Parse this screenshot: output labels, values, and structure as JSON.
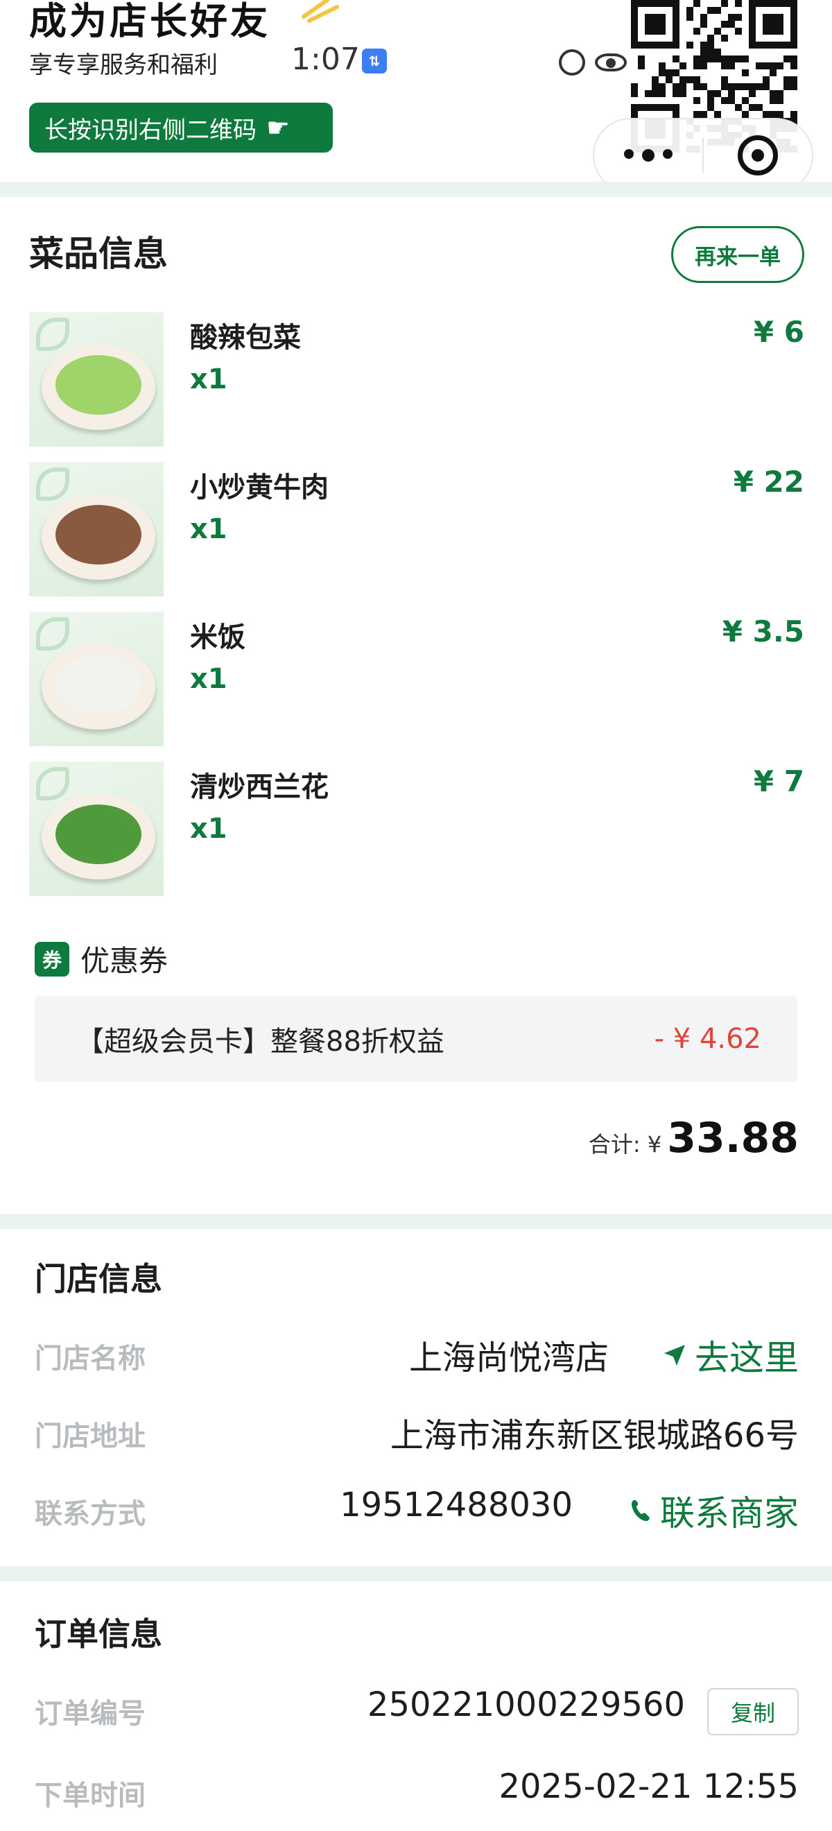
{
  "banner": {
    "title": "成为店长好友",
    "subtitle": "享专享服务和福利",
    "scan_hint": "长按识别右侧二维码",
    "scan_icon": "hand-pointing-icon"
  },
  "status_bar": {
    "time": "1:07",
    "badge": "⇅"
  },
  "dishes_section": {
    "title": "菜品信息",
    "reorder_label": "再来一单",
    "items": [
      {
        "name": "酸辣包菜",
        "qty": "x1",
        "price": "¥ 6",
        "food_color": "#9fd46a"
      },
      {
        "name": "小炒黄牛肉",
        "qty": "x1",
        "price": "¥ 22",
        "food_color": "#8a5a40"
      },
      {
        "name": "米饭",
        "qty": "x1",
        "price": "¥ 3.5",
        "food_color": "#f2f2ef"
      },
      {
        "name": "清炒西兰花",
        "qty": "x1",
        "price": "¥ 7",
        "food_color": "#4f9a3a"
      }
    ]
  },
  "coupon": {
    "tag": "券",
    "title": "优惠券",
    "name": "【超级会员卡】整餐88折权益",
    "discount": "- ¥ 4.62"
  },
  "total": {
    "label": "合计: ¥",
    "value": "33.88"
  },
  "store_section": {
    "title": "门店信息",
    "name_label": "门店名称",
    "name_value": "上海尚悦湾店",
    "navigate_label": "去这里",
    "address_label": "门店地址",
    "address_value": "上海市浦东新区银城路66号",
    "contact_label": "联系方式",
    "contact_value": "19512488030",
    "call_label": "联系商家"
  },
  "order_section": {
    "title": "订单信息",
    "number_label": "订单编号",
    "number_value": "250221000229560",
    "copy_label": "复制",
    "time_label": "下单时间",
    "time_value": "2025-02-21 12:55"
  },
  "colors": {
    "brand_green": "#0e7a3d",
    "discount_red": "#e0433a",
    "band": "#eaf2f2"
  }
}
